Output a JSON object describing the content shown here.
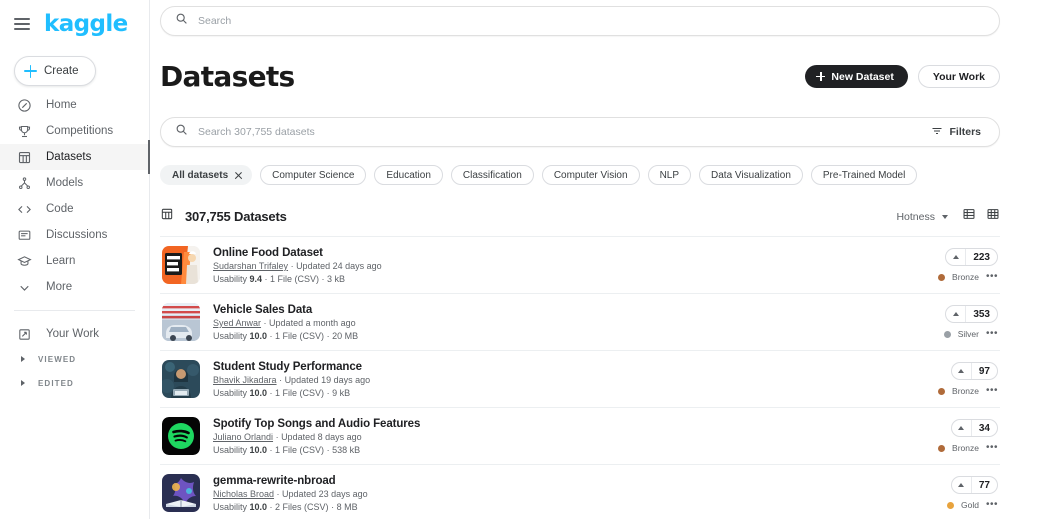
{
  "sidebar": {
    "logo": "kaggle",
    "create_label": "Create",
    "items": [
      {
        "label": "Home",
        "icon": "compass-icon",
        "active": false
      },
      {
        "label": "Competitions",
        "icon": "trophy-icon",
        "active": false
      },
      {
        "label": "Datasets",
        "icon": "table-icon",
        "active": true
      },
      {
        "label": "Models",
        "icon": "models-icon",
        "active": false
      },
      {
        "label": "Code",
        "icon": "code-icon",
        "active": false
      },
      {
        "label": "Discussions",
        "icon": "discussions-icon",
        "active": false
      },
      {
        "label": "Learn",
        "icon": "graduation-cap-icon",
        "active": false
      },
      {
        "label": "More",
        "icon": "chevron-down-icon",
        "active": false
      }
    ],
    "your_work": "Your Work",
    "sections": [
      {
        "label": "VIEWED"
      },
      {
        "label": "EDITED"
      }
    ]
  },
  "top_search": {
    "placeholder": "Search",
    "value": ""
  },
  "header": {
    "title": "Datasets",
    "new_dataset_label": "New Dataset",
    "your_work_label": "Your Work"
  },
  "search": {
    "placeholder": "Search 307,755 datasets",
    "value": "",
    "filters_label": "Filters"
  },
  "chips": [
    {
      "label": "All datasets",
      "selected": true
    },
    {
      "label": "Computer Science",
      "selected": false
    },
    {
      "label": "Education",
      "selected": false
    },
    {
      "label": "Classification",
      "selected": false
    },
    {
      "label": "Computer Vision",
      "selected": false
    },
    {
      "label": "NLP",
      "selected": false
    },
    {
      "label": "Data Visualization",
      "selected": false
    },
    {
      "label": "Pre-Trained Model",
      "selected": false
    }
  ],
  "results": {
    "count_label": "307,755 Datasets",
    "sort_label": "Hotness",
    "view_list_icon": "list-view-icon",
    "view_grid_icon": "grid-view-icon"
  },
  "colors": {
    "brand": "#20beff",
    "bronze": "#b06b3a",
    "silver": "#9aa0a6",
    "gold": "#e8a33d",
    "dark": "#202124"
  },
  "datasets": [
    {
      "title": "Online Food Dataset",
      "author": "Sudarshan Trifaley",
      "updated": "Updated 24 days ago",
      "usability": "9.4",
      "files": "1 File (CSV)",
      "size": "3 kB",
      "votes": "223",
      "medal": "Bronze",
      "medal_color": "#b06b3a",
      "thumb": "online-food-order"
    },
    {
      "title": "Vehicle Sales Data",
      "author": "Syed Anwar",
      "updated": "Updated a month ago",
      "usability": "10.0",
      "files": "1 File (CSV)",
      "size": "20 MB",
      "votes": "353",
      "medal": "Silver",
      "medal_color": "#9aa0a6",
      "thumb": "vehicle-flag"
    },
    {
      "title": "Student Study Performance",
      "author": "Bhavik Jikadara",
      "updated": "Updated 19 days ago",
      "usability": "10.0",
      "files": "1 File (CSV)",
      "size": "9 kB",
      "votes": "97",
      "medal": "Bronze",
      "medal_color": "#b06b3a",
      "thumb": "student-study"
    },
    {
      "title": "Spotify Top Songs and Audio Features",
      "author": "Juliano Orlandi",
      "updated": "Updated 8 days ago",
      "usability": "10.0",
      "files": "1 File (CSV)",
      "size": "538 kB",
      "votes": "34",
      "medal": "Bronze",
      "medal_color": "#b06b3a",
      "thumb": "spotify"
    },
    {
      "title": "gemma-rewrite-nbroad",
      "author": "Nicholas Broad",
      "updated": "Updated 23 days ago",
      "usability": "10.0",
      "files": "2 Files (CSV)",
      "size": "8 MB",
      "votes": "77",
      "medal": "Gold",
      "medal_color": "#e8a33d",
      "thumb": "gemma-book"
    }
  ]
}
